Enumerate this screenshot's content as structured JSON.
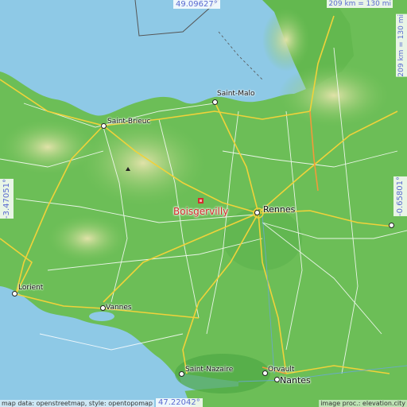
{
  "coords": {
    "top": "49.09627°",
    "bottom": "47.22042°",
    "left": "-3.47051°",
    "right": "-0.65801°"
  },
  "scale": {
    "horizontal": "209 km = 130 mi",
    "vertical": "209 km = 130 mi"
  },
  "target": {
    "name": "Boisgervilly"
  },
  "places": {
    "saint_malo": "Saint-Malo",
    "saint_brieuc": "Saint-Brieuc",
    "rennes": "Rennes",
    "lorient": "Lorient",
    "vannes": "Vannes",
    "saint_nazaire": "Saint-Nazaire",
    "orvault": "Orvault",
    "nantes": "Nantes"
  },
  "footer": {
    "left": "map data: openstreetmap, style: opentopomap",
    "right": "image proc.: elevation.city"
  },
  "colors": {
    "sea": "#8ec9e6",
    "land_low": "#6fc45a",
    "land_high": "#d8dc98",
    "motorway": "#f0d23a",
    "target": "#d42a2a",
    "coord_text": "#5a6ad0"
  }
}
